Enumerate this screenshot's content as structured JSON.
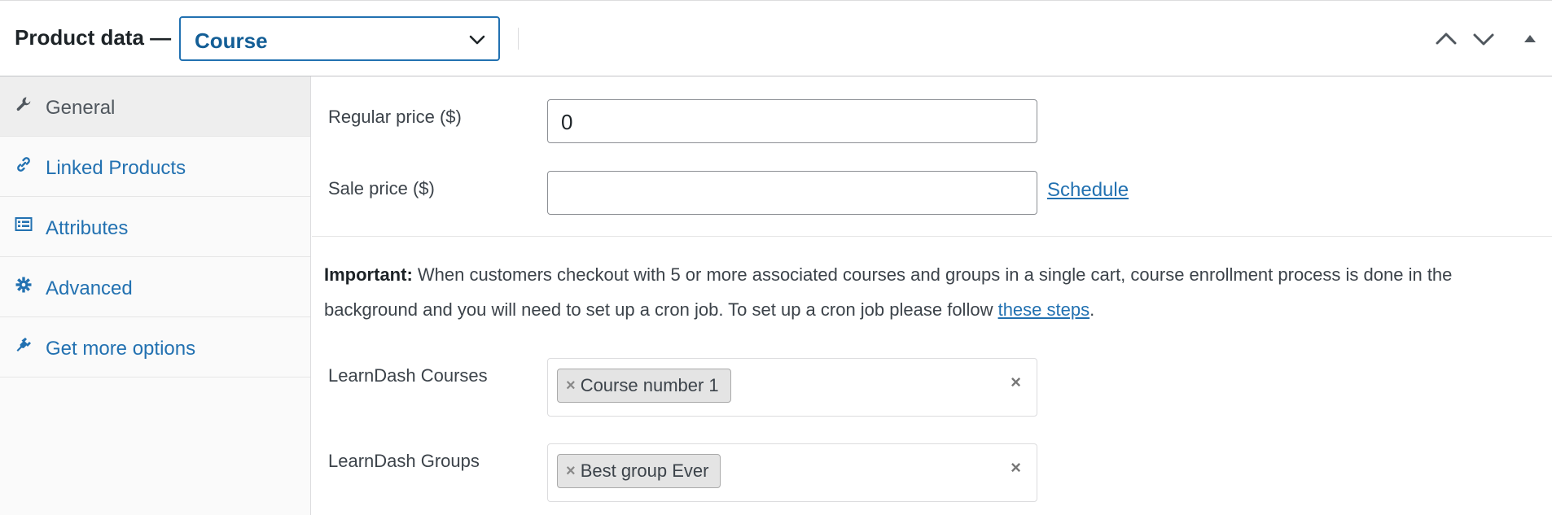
{
  "header": {
    "title": "Product data —",
    "product_type": {
      "selected": "Course",
      "icon": "chevron-down-icon"
    },
    "buttons": [
      {
        "name": "move-up-button",
        "icon": "chevron-up-icon"
      },
      {
        "name": "move-down-button",
        "icon": "chevron-down-icon"
      },
      {
        "name": "toggle-panel-button",
        "icon": "triangle-up-icon"
      }
    ]
  },
  "sidebar": {
    "items": [
      {
        "label": "General",
        "icon": "wrench-icon",
        "active": true
      },
      {
        "label": "Linked Products",
        "icon": "link-icon",
        "active": false
      },
      {
        "label": "Attributes",
        "icon": "list-view-icon",
        "active": false
      },
      {
        "label": "Advanced",
        "icon": "gear-icon",
        "active": false
      },
      {
        "label": "Get more options",
        "icon": "plugin-icon",
        "active": false
      }
    ]
  },
  "main": {
    "regular_price": {
      "label": "Regular price ($)",
      "value": "0"
    },
    "sale_price": {
      "label": "Sale price ($)",
      "value": "",
      "schedule_link": "Schedule"
    },
    "notice": {
      "strong": "Important:",
      "text": " When customers checkout with 5 or more associated courses and groups in a single cart, course enrollment process is done in the background and you will need to set up a cron job. To set up a cron job please follow ",
      "link": "these steps",
      "end": "."
    },
    "courses": {
      "label": "LearnDash Courses",
      "chips": [
        "Course number 1"
      ],
      "clear": "×",
      "chip_remove": "×"
    },
    "groups": {
      "label": "LearnDash Groups",
      "chips": [
        "Best group Ever"
      ],
      "clear": "×",
      "chip_remove": "×"
    }
  },
  "colors": {
    "accent": "#2271b1",
    "accent_dark": "#135e96",
    "active_tab_bg": "#eeeeee",
    "sidebar_bg": "#fafafa"
  }
}
